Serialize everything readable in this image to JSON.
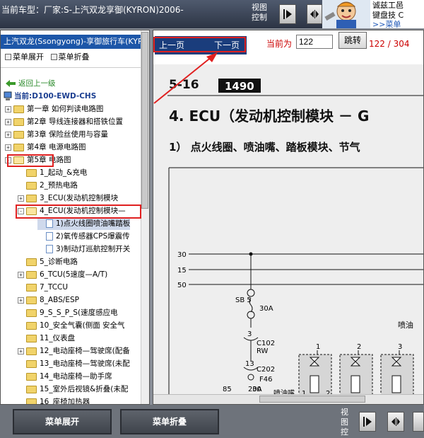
{
  "topbar": {
    "car_title": "当前车型：厂家:S-上汽双龙享御(KYRON)2006-",
    "view_ctrl": "视图\n控制",
    "ad_text": "诚兹工邑\n键盘技 C\n字！",
    "ad_link": ">>菜单"
  },
  "tree": {
    "title": "上汽双龙(Ssongyong)-享御旅行车(KYR",
    "expand_label": "菜单展开",
    "collapse_label": "菜单折叠",
    "back_label": "返回上一级",
    "current_label": "当前:D100-EWD-CHS",
    "items": [
      {
        "label": "第一章 如何判读电路图",
        "pm": "+",
        "type": "folder"
      },
      {
        "label": "第2章 导线连接器和搭铁位置",
        "pm": "+",
        "type": "folder"
      },
      {
        "label": "第3章 保险丝使用与容量",
        "pm": "+",
        "type": "folder"
      },
      {
        "label": "第4章 电源电路图",
        "pm": "+",
        "type": "folder"
      },
      {
        "label": "第5章 电路图",
        "pm": "-",
        "type": "folder-open"
      },
      {
        "label": "1_起动_&充电",
        "type": "folder"
      },
      {
        "label": "2_预热电路",
        "type": "folder"
      },
      {
        "label": "3_ECU(发动机控制模块",
        "pm": "+",
        "type": "folder"
      },
      {
        "label": "4_ECU(发动机控制模块—",
        "pm": "-",
        "type": "folder-open"
      },
      {
        "label": "1)点火线圈喷油嘴踏板",
        "type": "doc"
      },
      {
        "label": "2)氧传感器CPS爆震传",
        "type": "doc"
      },
      {
        "label": "3)制动灯巡航控制开关",
        "type": "doc"
      },
      {
        "label": "5_诊断电路",
        "type": "folder"
      },
      {
        "label": "6_TCU(5速度—A/T)",
        "pm": "+",
        "type": "folder"
      },
      {
        "label": "7_TCCU",
        "type": "folder"
      },
      {
        "label": "8_ABS/ESP",
        "pm": "+",
        "type": "folder"
      },
      {
        "label": "9_S_S_P_S(速度感应电",
        "type": "folder"
      },
      {
        "label": "10_安全气囊(侧面 安全气",
        "type": "folder"
      },
      {
        "label": "11_仪表盘",
        "type": "folder"
      },
      {
        "label": "12_电动座椅—驾驶席(配备",
        "pm": "+",
        "type": "folder"
      },
      {
        "label": "13_电动座椅—驾驶席(未配",
        "type": "folder"
      },
      {
        "label": "14_电动座椅—助手席",
        "type": "folder"
      },
      {
        "label": "15_室外后视镜&折叠(未配",
        "type": "folder"
      },
      {
        "label": "16_座椅加热器",
        "type": "folder"
      }
    ]
  },
  "pager": {
    "prev_label": "上一页",
    "next_label": "下一页",
    "current_label": "当前为",
    "page_value": "122",
    "jump_label": "跳转",
    "page_count": "122 / 304"
  },
  "diagram": {
    "section": "5-16",
    "page_badge": "1490",
    "heading": "4. ECU（发动机控制模块 －  G",
    "subheading": "1） 点火线圈、喷油嘴、踏板模块、节气",
    "rail_30": "30",
    "rail_15": "15",
    "rail_50": "50",
    "fuse_sb": "SB 5",
    "fuse_sb_amp": "30A",
    "conn_c102_pin": "3",
    "conn_c102": "C102",
    "conn_c102_color": "RW",
    "conn_c202_pin": "13",
    "conn_c202": "C202",
    "fuse_f46": "F46",
    "fuse_f46_amp": "20A",
    "relay_85": "85",
    "relay_30": "30",
    "injector_label": "喷油",
    "injector_1": "1",
    "injector_2": "2",
    "injector_3": "3",
    "pin_1": "1",
    "pin_2": "2",
    "bottom_partial": "喷油嘴"
  },
  "bottom": {
    "expand_button": "菜单展开",
    "collapse_button": "菜单折叠",
    "view_label": "视图控"
  }
}
